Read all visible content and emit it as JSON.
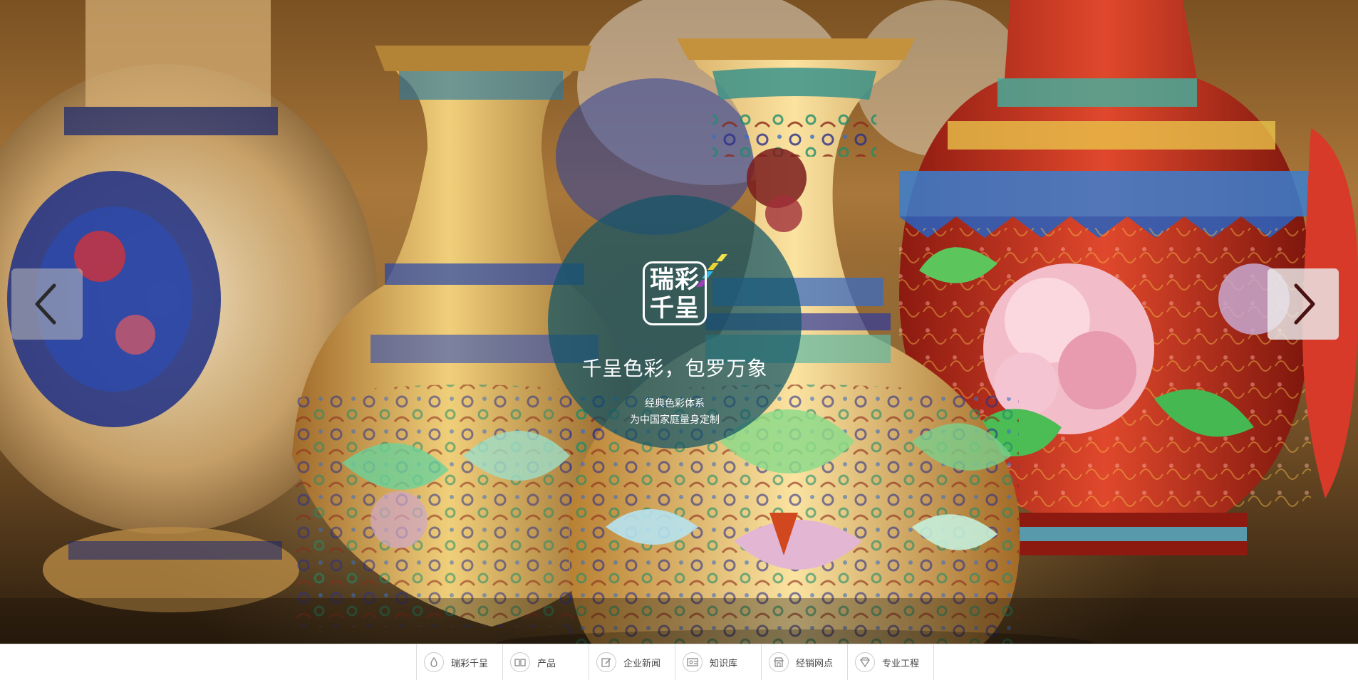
{
  "hero": {
    "logo_line1": "瑞彩",
    "logo_line2": "千呈",
    "slogan": "千呈色彩，包罗万象",
    "subtitle_line1": "经典色彩体系",
    "subtitle_line2": "为中国家庭量身定制"
  },
  "colors": {
    "circle": "#125466",
    "nav_text": "#444444",
    "nav_border": "#dcdcdc"
  },
  "nav": {
    "items": [
      {
        "label": "瑞彩千呈",
        "icon": "drop-icon"
      },
      {
        "label": "产品",
        "icon": "paint-cans-icon"
      },
      {
        "label": "企业新闻",
        "icon": "pencil-note-icon"
      },
      {
        "label": "知识库",
        "icon": "knowledge-card-icon"
      },
      {
        "label": "经销网点",
        "icon": "store-icon"
      },
      {
        "label": "专业工程",
        "icon": "diamond-icon"
      }
    ]
  }
}
